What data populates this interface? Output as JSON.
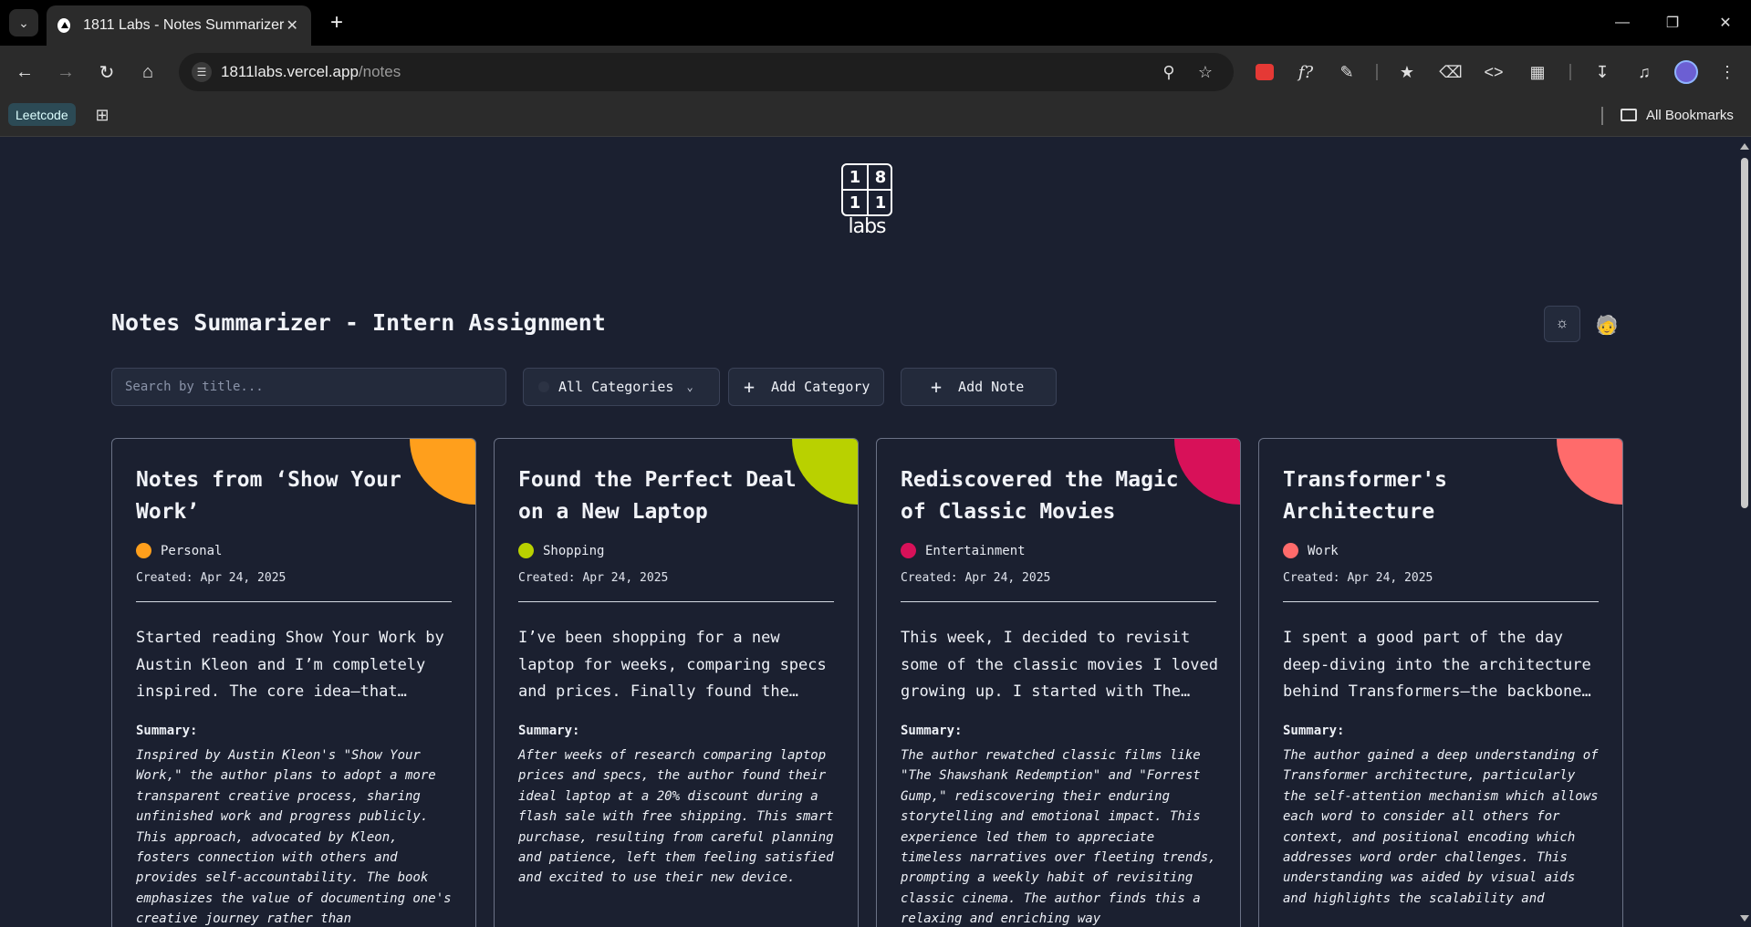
{
  "browser": {
    "tab_title": "1811 Labs - Notes Summarizer",
    "url_host": "1811labs.vercel.app",
    "url_path": "/notes",
    "bookmarks": {
      "leetcode": "Leetcode",
      "all": "All Bookmarks"
    }
  },
  "logo": {
    "cells": [
      "1",
      "8",
      "1",
      "1"
    ],
    "word": "labs"
  },
  "header": {
    "title": "Notes Summarizer - Intern Assignment"
  },
  "controls": {
    "search_placeholder": "Search by title...",
    "category_filter": "All Categories",
    "add_category": "Add Category",
    "add_note": "Add Note"
  },
  "notes": [
    {
      "title": "Notes from ‘Show Your Work’",
      "category": "Personal",
      "color": "#ff9f1c",
      "created": "Created: Apr 24, 2025",
      "body": "Started reading Show Your Work by Austin Kleon and I’m completely inspired. The core idea—that…",
      "summary_label": "Summary:",
      "summary": "Inspired by Austin Kleon's \"Show Your Work,\" the author plans to adopt a more transparent creative process, sharing unfinished work and progress publicly. This approach, advocated by Kleon, fosters connection with others and provides self-accountability. The book emphasizes the value of documenting one's creative journey rather than"
    },
    {
      "title": "Found the Perfect Deal on a New Laptop",
      "category": "Shopping",
      "color": "#b9d100",
      "created": "Created: Apr 24, 2025",
      "body": "I’ve been shopping for a new laptop for weeks, comparing specs and prices. Finally found the…",
      "summary_label": "Summary:",
      "summary": "After weeks of research comparing laptop prices and specs, the author found their ideal laptop at a 20% discount during a flash sale with free shipping. This smart purchase, resulting from careful planning and patience, left them feeling satisfied and excited to use their new device."
    },
    {
      "title": "Rediscovered the Magic of Classic Movies",
      "category": "Entertainment",
      "color": "#d81159",
      "created": "Created: Apr 24, 2025",
      "body": "This week, I decided to revisit some of the classic movies I loved growing up. I started with The…",
      "summary_label": "Summary:",
      "summary": "The author rewatched classic films like \"The Shawshank Redemption\" and \"Forrest Gump,\" rediscovering their enduring storytelling and emotional impact. This experience led them to appreciate timeless narratives over fleeting trends, prompting a weekly habit of revisiting classic cinema. The author finds this a relaxing and enriching way"
    },
    {
      "title": "Transformer's Architecture",
      "category": "Work",
      "color": "#ff6b6b",
      "created": "Created: Apr 24, 2025",
      "body": "I spent a good part of the day deep-diving into the architecture behind Transformers—the backbone…",
      "summary_label": "Summary:",
      "summary": "The author gained a deep understanding of Transformer architecture, particularly the self-attention mechanism which allows each word to consider all others for context, and positional encoding which addresses word order challenges. This understanding was aided by visual aids and highlights the scalability and"
    }
  ]
}
